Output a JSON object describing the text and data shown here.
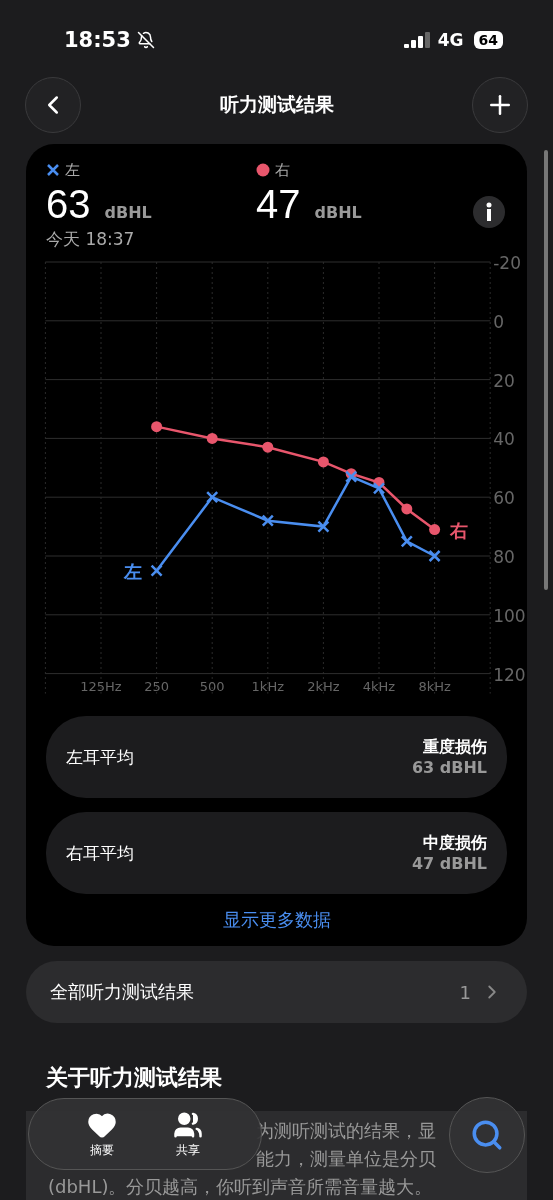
{
  "status_bar": {
    "time": "18:53",
    "network": "4G",
    "battery": "64"
  },
  "nav": {
    "title": "听力测试结果"
  },
  "summary": {
    "left": {
      "label": "左",
      "value": "63",
      "unit": "dBHL",
      "color": "#4a8ef0"
    },
    "right": {
      "label": "右",
      "value": "47",
      "unit": "dBHL",
      "color": "#e8566c"
    },
    "time": "今天 18:37"
  },
  "audiogram": {
    "chart_data": {
      "type": "line",
      "categories": [
        "125Hz",
        null,
        "250",
        null,
        "500",
        null,
        "1kHz",
        null,
        "2kHz",
        null,
        "4kHz",
        null,
        "8kHz"
      ],
      "ylim": [
        120,
        -20
      ],
      "grid": true,
      "yticks": [
        -20,
        0,
        20,
        40,
        60,
        80,
        100,
        120
      ],
      "series": [
        {
          "name": "左",
          "color": "#4a8ef0",
          "marker": "x",
          "values": [
            null,
            null,
            85,
            null,
            60,
            null,
            68,
            null,
            70,
            53,
            57,
            75,
            80
          ]
        },
        {
          "name": "右",
          "color": "#e8566c",
          "marker": "circle",
          "values": [
            null,
            null,
            36,
            null,
            40,
            null,
            43,
            null,
            48,
            52,
            55,
            64,
            71
          ]
        }
      ]
    }
  },
  "averages": [
    {
      "label": "左耳平均",
      "grade": "重度损伤",
      "value": "63 dBHL"
    },
    {
      "label": "右耳平均",
      "grade": "中度损伤",
      "value": "47 dBHL"
    }
  ],
  "more_link": "显示更多数据",
  "all_results": {
    "label": "全部听力测试结果",
    "count": "1"
  },
  "about": {
    "title": "关于听力测试结果",
    "lines": [
      "为测听测试的结果，显",
      "能力，测量单位是分贝",
      "(dbHL)。分贝越高，你听到声音所需音量越大。"
    ]
  },
  "tab_bar": [
    {
      "label": "摘要",
      "kind": "heart"
    },
    {
      "label": "共享",
      "kind": "people"
    }
  ]
}
